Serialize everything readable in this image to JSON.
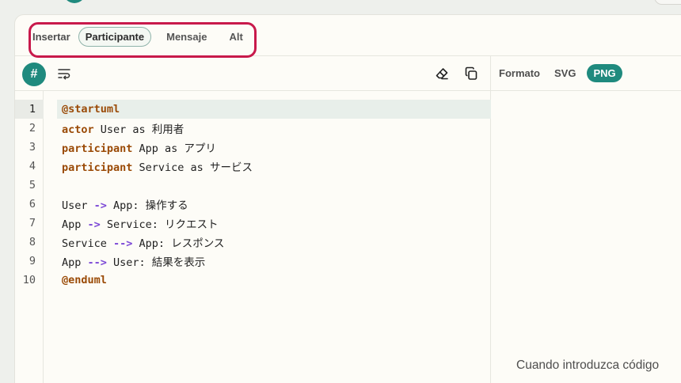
{
  "insert_bar": {
    "label": "Insertar",
    "buttons": [
      "Participante",
      "Mensaje",
      "Alt"
    ]
  },
  "toolbar": {
    "hash_label": "#"
  },
  "editor": {
    "line_numbers": [
      "1",
      "2",
      "3",
      "4",
      "5",
      "6",
      "7",
      "8",
      "9",
      "10"
    ],
    "active_line": 1
  },
  "code": [
    {
      "segments": [
        {
          "t": "@startuml",
          "c": "kw"
        }
      ]
    },
    {
      "segments": [
        {
          "t": "actor",
          "c": "kw"
        },
        {
          "t": " User as 利用者",
          "c": ""
        }
      ]
    },
    {
      "segments": [
        {
          "t": "participant",
          "c": "kw"
        },
        {
          "t": " App as アプリ",
          "c": ""
        }
      ]
    },
    {
      "segments": [
        {
          "t": "participant",
          "c": "kw"
        },
        {
          "t": " Service as サービス",
          "c": ""
        }
      ]
    },
    {
      "segments": []
    },
    {
      "segments": [
        {
          "t": "User ",
          "c": ""
        },
        {
          "t": "->",
          "c": "arrow"
        },
        {
          "t": " App: 操作する",
          "c": ""
        }
      ]
    },
    {
      "segments": [
        {
          "t": "App ",
          "c": ""
        },
        {
          "t": "->",
          "c": "arrow"
        },
        {
          "t": " Service: リクエスト",
          "c": ""
        }
      ]
    },
    {
      "segments": [
        {
          "t": "Service ",
          "c": ""
        },
        {
          "t": "-->",
          "c": "arrow"
        },
        {
          "t": " App: レスポンス",
          "c": ""
        }
      ]
    },
    {
      "segments": [
        {
          "t": "App ",
          "c": ""
        },
        {
          "t": "-->",
          "c": "arrow"
        },
        {
          "t": " User: 結果を表示",
          "c": ""
        }
      ]
    },
    {
      "segments": [
        {
          "t": "@enduml",
          "c": "kw"
        }
      ]
    }
  ],
  "format_bar": {
    "label": "Formato",
    "options": [
      "SVG",
      "PNG"
    ],
    "selected": "PNG"
  },
  "preview": {
    "placeholder": "Cuando introduzca código"
  },
  "colors": {
    "accent": "#1f8a7e",
    "highlight_border": "#c8194b",
    "keyword": "#9a4a06",
    "arrow": "#7b47d6"
  },
  "icons": [
    "hash-icon",
    "wrap-lines-icon",
    "eraser-icon",
    "copy-icon"
  ]
}
